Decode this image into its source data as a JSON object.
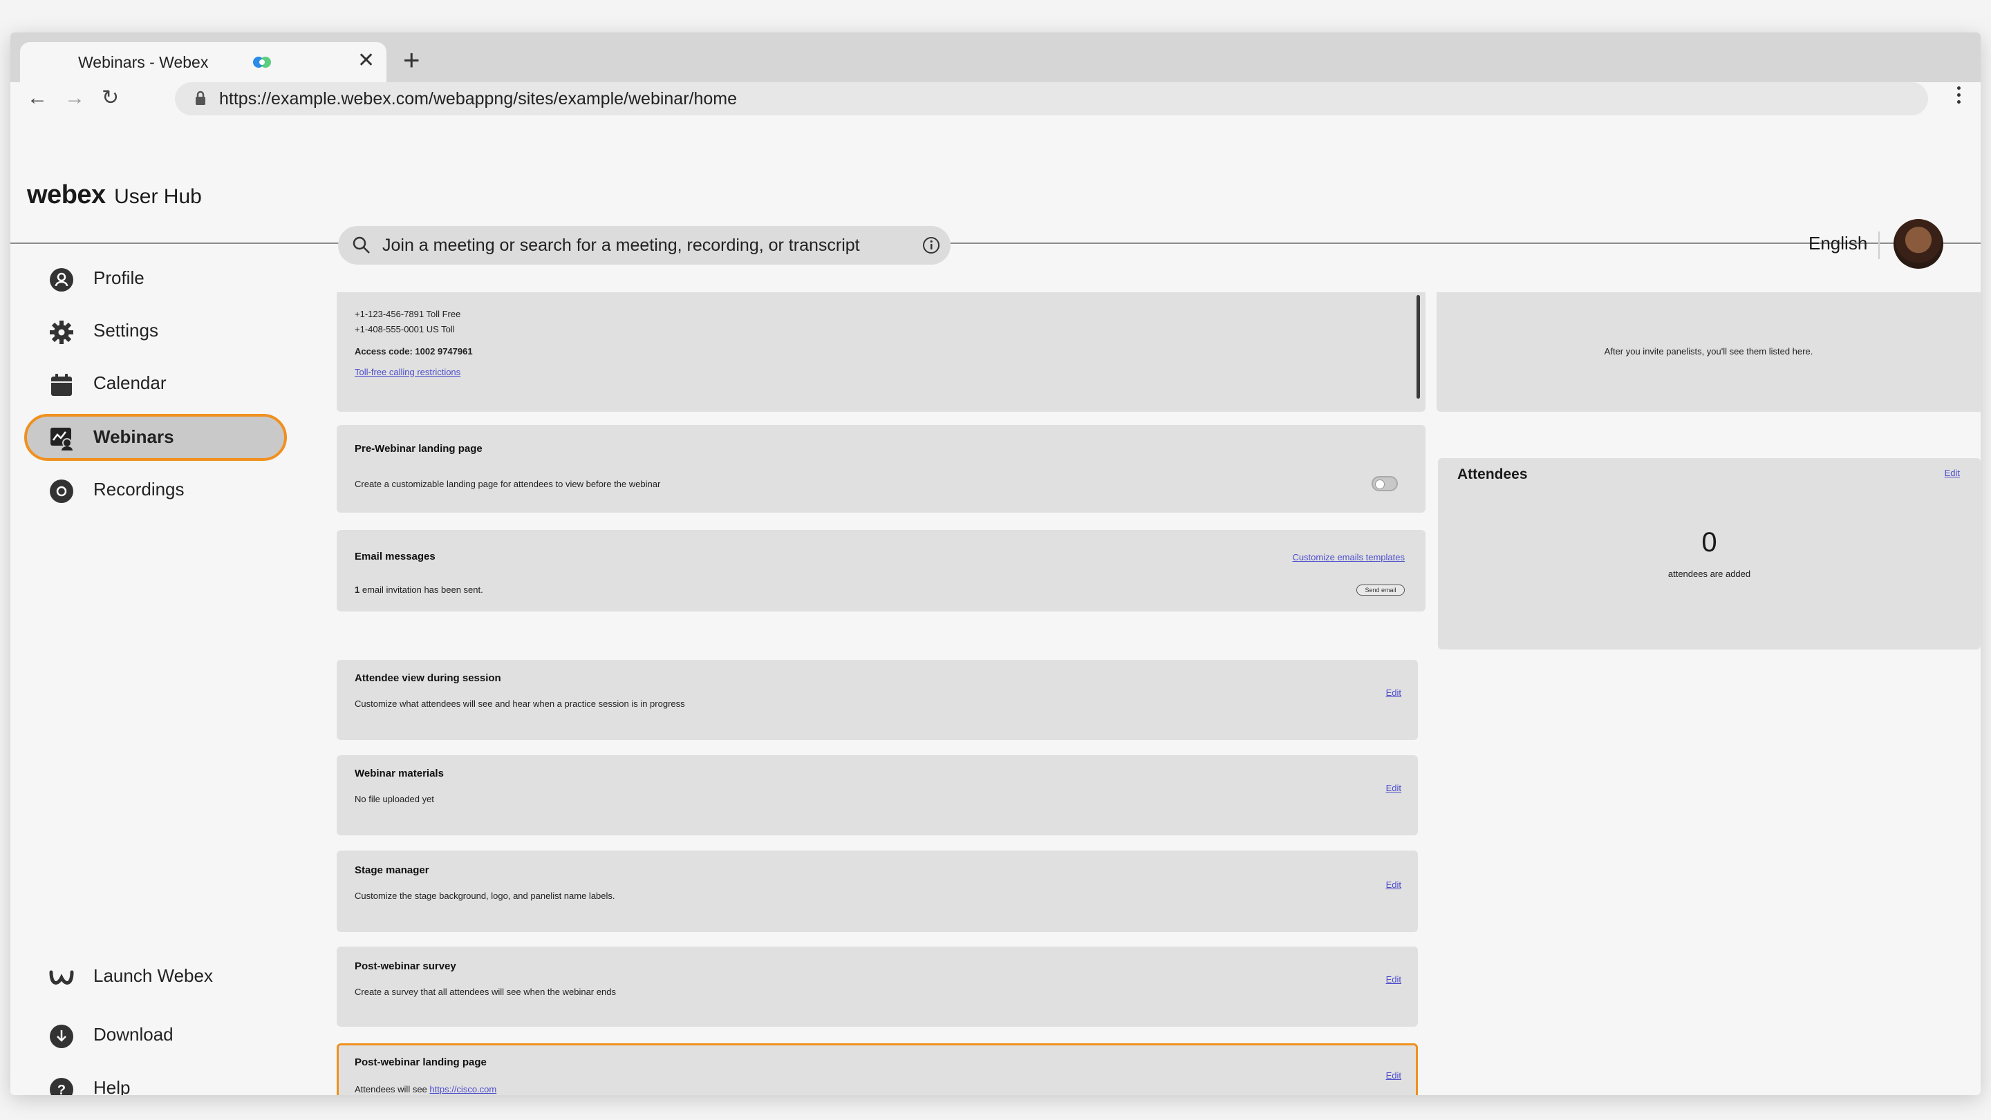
{
  "browser": {
    "tab_title": "Webinars - Webex",
    "tab_close": "✕",
    "new_tab": "+",
    "url": "https://example.webex.com/webappng/sites/example/webinar/home"
  },
  "brand": {
    "logo": "webex",
    "title": "User Hub"
  },
  "sidebar": {
    "items": [
      {
        "label": "Profile",
        "icon": "profile-icon"
      },
      {
        "label": "Settings",
        "icon": "gear-icon"
      },
      {
        "label": "Calendar",
        "icon": "calendar-icon"
      },
      {
        "label": "Webinars",
        "icon": "webinar-icon",
        "active": true
      },
      {
        "label": "Recordings",
        "icon": "recordings-icon"
      }
    ],
    "bottom_items": [
      {
        "label": "Launch Webex",
        "icon": "webex-logo-icon"
      },
      {
        "label": "Download",
        "icon": "download-icon"
      },
      {
        "label": "Help",
        "icon": "help-icon"
      }
    ]
  },
  "topbar": {
    "search_placeholder": "Join a meeting or search for a meeting, recording, or transcript",
    "language": "English"
  },
  "audio_card": {
    "phone1": "+1-123-456-7891 Toll Free",
    "phone2": "+1-408-555-0001 US Toll",
    "access_code": "Access code: 1002 9747961",
    "restrictions_link": "Toll-free calling restrictions"
  },
  "panelists_card": {
    "empty_text": "After you invite panelists, you'll see them listed here."
  },
  "pre_webinar": {
    "title": "Pre-Webinar landing page",
    "desc": "Create a customizable landing page for attendees to view before the webinar"
  },
  "email": {
    "title": "Email messages",
    "customize_link": "Customize emails templates",
    "count": "1",
    "desc": " email invitation has been sent.",
    "send_button": "Send email"
  },
  "cards": [
    {
      "title": "Attendee view during session",
      "desc": "Customize what attendees will see and hear when a practice session is in progress",
      "edit": "Edit"
    },
    {
      "title": "Webinar materials",
      "desc": "No file uploaded yet",
      "edit": "Edit"
    },
    {
      "title": "Stage manager",
      "desc": "Customize the stage background, logo, and panelist name labels.",
      "edit": "Edit"
    },
    {
      "title": "Post-webinar survey",
      "desc": "Create a survey that all attendees will see when the webinar ends",
      "edit": "Edit"
    }
  ],
  "post_landing": {
    "title": "Post-webinar landing page",
    "desc": "Attendees will see ",
    "link": "https://cisco.com",
    "edit": "Edit"
  },
  "attendees": {
    "title": "Attendees",
    "edit": "Edit",
    "count": "0",
    "sub": "attendees are added"
  },
  "colors": {
    "accent": "#f0901e",
    "link": "#4d4dcc"
  }
}
